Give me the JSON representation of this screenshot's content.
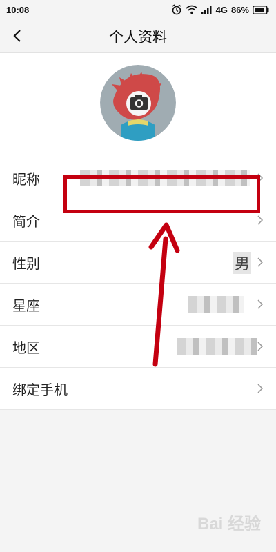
{
  "status": {
    "time": "10:08",
    "network": "4G",
    "battery": "86%"
  },
  "header": {
    "title": "个人资料"
  },
  "profile": {
    "avatar_icons": [
      "fire-mascot-icon",
      "camera-icon"
    ]
  },
  "rows": [
    {
      "label": "昵称"
    },
    {
      "label": "简介"
    },
    {
      "label": "性别",
      "value": "男"
    },
    {
      "label": "星座"
    },
    {
      "label": "地区"
    },
    {
      "label": "绑定手机"
    }
  ],
  "colors": {
    "annotation_red": "#c40010"
  },
  "watermark": "Bai 经验"
}
